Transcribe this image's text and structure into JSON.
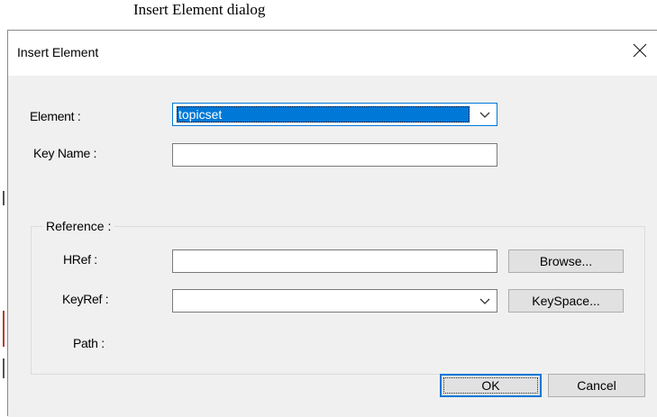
{
  "caption": "Insert Element dialog",
  "dialog": {
    "title": "Insert Element",
    "element_label": "Element :",
    "element_value": "topicset",
    "keyname_label": "Key Name :",
    "keyname_value": "",
    "reference": {
      "label": "Reference :",
      "href_label": "HRef :",
      "href_value": "",
      "browse_label": "Browse...",
      "keyref_label": "KeyRef :",
      "keyref_value": "",
      "keyspace_label": "KeySpace...",
      "path_label": "Path :"
    },
    "ok_label": "OK",
    "cancel_label": "Cancel"
  },
  "icons": {
    "close": "close-icon",
    "dropdown": "chevron-down-icon"
  },
  "colors": {
    "accent": "#0078d7",
    "client_bg": "#f0f0f0",
    "button_bg": "#e1e1e1"
  }
}
